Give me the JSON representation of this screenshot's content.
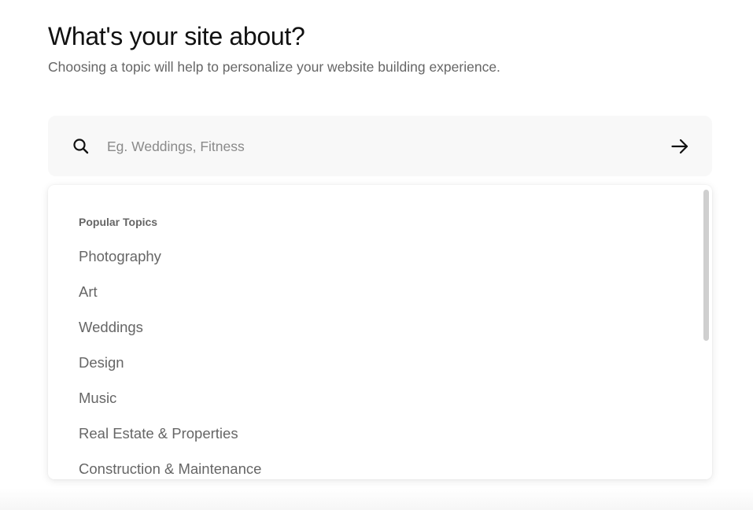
{
  "header": {
    "title": "What's your site about?",
    "subtitle": "Choosing a topic will help to personalize your website building experience."
  },
  "search": {
    "placeholder": "Eg. Weddings, Fitness",
    "value": "",
    "search_icon": "search-icon",
    "submit_icon": "arrow-right-icon"
  },
  "dropdown": {
    "section_label": "Popular Topics",
    "topics": [
      "Photography",
      "Art",
      "Weddings",
      "Design",
      "Music",
      "Real Estate & Properties",
      "Construction & Maintenance"
    ]
  },
  "colors": {
    "title": "#111111",
    "muted_text": "#666666",
    "search_background": "#f8f8f8",
    "scrollbar": "#cfcfcf"
  }
}
